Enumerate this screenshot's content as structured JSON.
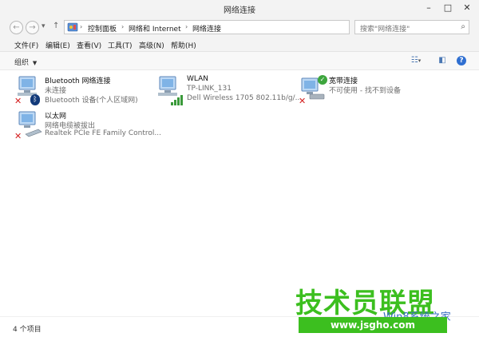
{
  "window": {
    "title": "网络连接"
  },
  "address": {
    "segments": [
      "控制面板",
      "网络和 Internet",
      "网络连接"
    ],
    "search_placeholder": "搜索\"网络连接\""
  },
  "menu": [
    "文件(F)",
    "编辑(E)",
    "查看(V)",
    "工具(T)",
    "高级(N)",
    "帮助(H)"
  ],
  "command": {
    "organize": "组织"
  },
  "connections": [
    {
      "name": "Bluetooth 网络连接",
      "status": "未连接",
      "device": "Bluetooth 设备(个人区域网)"
    },
    {
      "name": "WLAN",
      "status": "TP-LINK_131",
      "device": "Dell Wireless 1705 802.11b/g/..."
    },
    {
      "name": "宽带连接",
      "status": "不可使用 - 找不到设备",
      "device": ""
    },
    {
      "name": "以太网",
      "status": "网络电缆被拔出",
      "device": "Realtek PCIe FE Family Control..."
    }
  ],
  "statusbar": {
    "count": "4 个项目"
  },
  "watermark": {
    "text": "技术员联盟",
    "url": "www.jsgho.com",
    "sub": "Win8系统之家"
  },
  "colors": {
    "watermark_green": "#3cbf1f",
    "accent_blue": "#4a77b3",
    "error_red": "#d42020"
  }
}
